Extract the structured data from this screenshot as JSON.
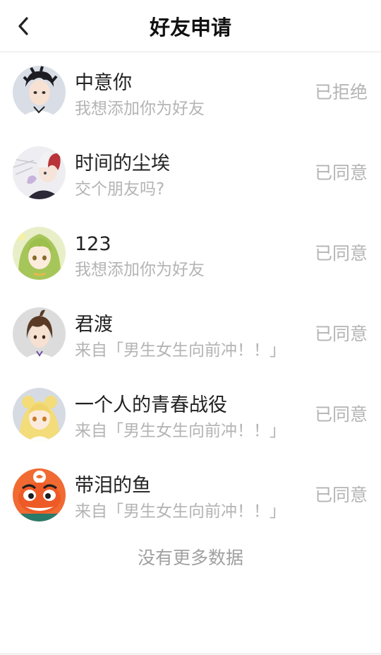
{
  "header": {
    "title": "好友申请",
    "back_icon": "chevron-left-icon"
  },
  "requests": [
    {
      "name": "中意你",
      "message": "我想添加你为好友",
      "status": "已拒绝"
    },
    {
      "name": "时间的尘埃",
      "message": "交个朋友吗?",
      "status": "已同意"
    },
    {
      "name": "123",
      "message": "我想添加你为好友",
      "status": "已同意"
    },
    {
      "name": "君渡",
      "message": "来自「男生女生向前冲！！」",
      "status": "已同意"
    },
    {
      "name": "一个人的青春战役",
      "message": "来自「男生女生向前冲！！」",
      "status": "已同意"
    },
    {
      "name": "带泪的鱼",
      "message": "来自「男生女生向前冲！！」",
      "status": "已同意"
    }
  ],
  "footer": {
    "no_more": "没有更多数据"
  },
  "colors": {
    "title": "#111111",
    "name": "#222222",
    "secondary": "#b4b4b4",
    "divider": "#e6e6e6"
  }
}
